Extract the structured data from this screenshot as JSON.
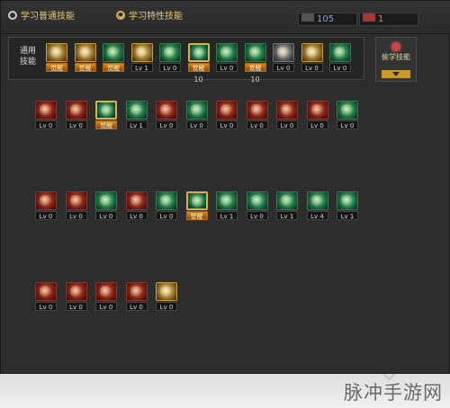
{
  "tabs": {
    "common": "学习普通技能",
    "special": "学习特性技能"
  },
  "counters": {
    "sp": "105",
    "tp": "1"
  },
  "common_label": "通用\n技能",
  "side_button": {
    "label": "偷学技能"
  },
  "common_skills": [
    {
      "color": "gold",
      "level": "觉醒",
      "awak": true
    },
    {
      "color": "gold",
      "level": "觉醒",
      "awak": true
    },
    {
      "color": "green",
      "level": "觉醒",
      "awak": true
    },
    {
      "color": "gold",
      "level": "Lv 1",
      "awak": false
    },
    {
      "color": "green",
      "level": "Lv 0",
      "awak": false
    },
    {
      "color": "green",
      "level": "觉醒",
      "awak": true,
      "selected": true,
      "under": "10"
    },
    {
      "color": "green",
      "level": "Lv 0",
      "awak": false
    },
    {
      "color": "green",
      "level": "觉醒",
      "awak": true,
      "under": "10"
    },
    {
      "color": "gray",
      "level": "Lv 0",
      "awak": false
    },
    {
      "color": "gold",
      "level": "Lv 0",
      "awak": false
    },
    {
      "color": "green",
      "level": "Lv 0",
      "awak": false
    }
  ],
  "row1": [
    {
      "color": "red",
      "level": "Lv 0",
      "awak": false
    },
    {
      "color": "red",
      "level": "Lv 0",
      "awak": false
    },
    {
      "color": "green",
      "level": "觉醒",
      "awak": true,
      "selected": true
    },
    {
      "color": "green",
      "level": "Lv 1",
      "awak": false
    },
    {
      "color": "red",
      "level": "Lv 0",
      "awak": false
    },
    {
      "color": "green",
      "level": "Lv 0",
      "awak": false
    },
    {
      "color": "red",
      "level": "Lv 0",
      "awak": false
    },
    {
      "color": "red",
      "level": "Lv 0",
      "awak": false
    },
    {
      "color": "red",
      "level": "Lv 0",
      "awak": false
    },
    {
      "color": "red",
      "level": "Lv 0",
      "awak": false
    },
    {
      "color": "green",
      "level": "Lv 0",
      "awak": false
    }
  ],
  "row2": [
    {
      "color": "red",
      "level": "Lv 0",
      "awak": false
    },
    {
      "color": "red",
      "level": "Lv 0",
      "awak": false
    },
    {
      "color": "green",
      "level": "Lv 0",
      "awak": false
    },
    {
      "color": "red",
      "level": "Lv 0",
      "awak": false
    },
    {
      "color": "green",
      "level": "Lv 0",
      "awak": false
    },
    {
      "color": "green",
      "level": "觉醒",
      "awak": true,
      "selected": true
    },
    {
      "color": "green",
      "level": "Lv 1",
      "awak": false
    },
    {
      "color": "green",
      "level": "Lv 0",
      "awak": false
    },
    {
      "color": "green",
      "level": "Lv 1",
      "awak": false
    },
    {
      "color": "green",
      "level": "Lv 4",
      "awak": false
    },
    {
      "color": "green",
      "level": "Lv 1",
      "awak": false
    }
  ],
  "row3": [
    {
      "color": "red",
      "level": "Lv 0",
      "awak": false
    },
    {
      "color": "red",
      "level": "Lv 0",
      "awak": false
    },
    {
      "color": "red",
      "level": "Lv 0",
      "awak": false
    },
    {
      "color": "red",
      "level": "Lv 0",
      "awak": false
    },
    {
      "color": "gold",
      "level": "Lv 0",
      "awak": false
    }
  ],
  "watermark": "脉冲手游网",
  "colors": {
    "accent_gold": "#e3c97a",
    "awaken_orange": "#d88a1c",
    "sp_blue": "#5ab6ff",
    "tp_orange": "#ff7a45"
  }
}
